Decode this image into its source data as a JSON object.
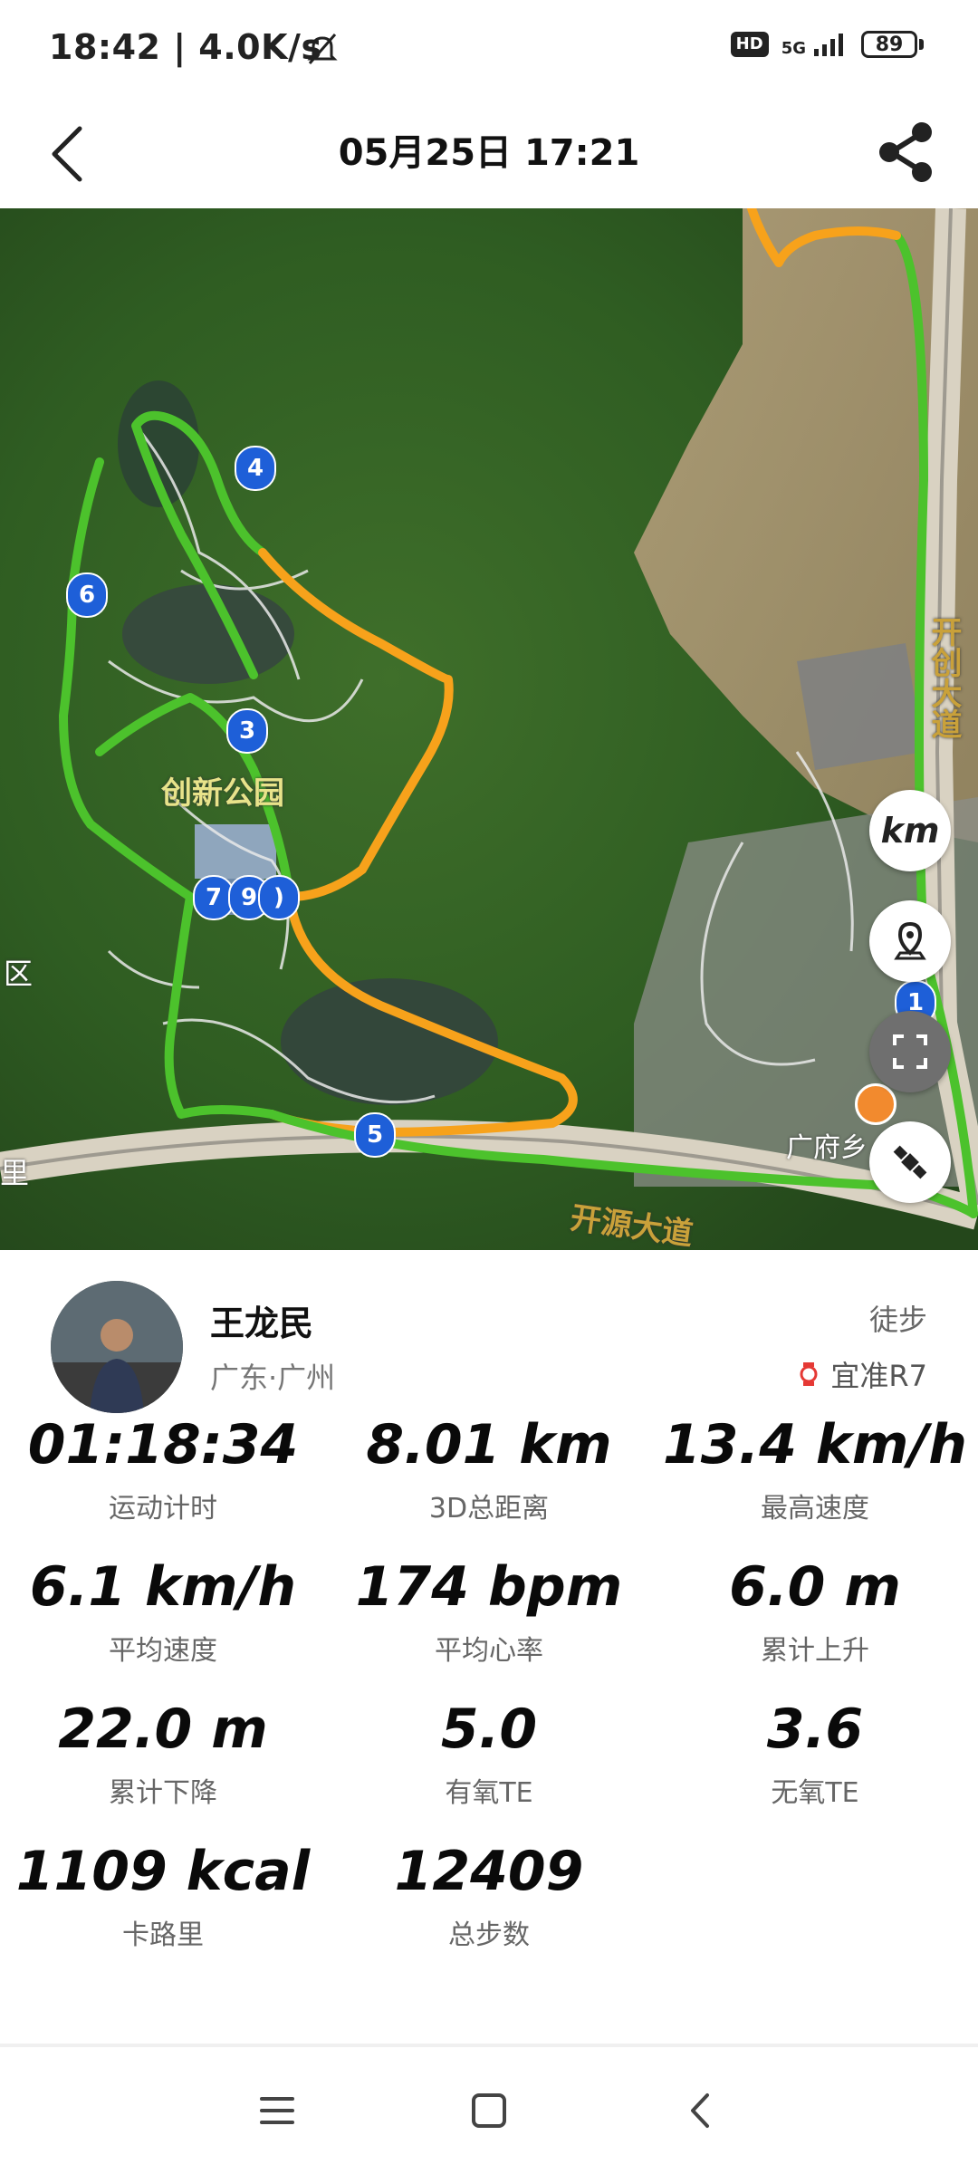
{
  "status_bar": {
    "time_speed": "18:42 | 4.0K/s",
    "hd_badge": "HD",
    "network": "5G",
    "battery": "89"
  },
  "header": {
    "title": "05月25日 17:21"
  },
  "map": {
    "place_label_park": "创新公园",
    "road_label_bottom": "开源大道",
    "road_label_right": "开创大道",
    "poi_label": "广府乡",
    "edge_label_left": "区",
    "edge_label_left_bottom": "里",
    "markers": [
      "4",
      "6",
      "3",
      "7",
      "9",
      ")",
      "1",
      "5"
    ],
    "unit_button": "km",
    "colors": {
      "route_green": "#4cc22c",
      "route_orange": "#f7a21b",
      "marker": "#1e5fd8"
    }
  },
  "profile": {
    "name": "王龙民",
    "location": "广东·广州",
    "activity_type": "徒步",
    "device": "宜准R7"
  },
  "stats": [
    {
      "value": "01:18:34",
      "label": "运动计时"
    },
    {
      "value": "8.01 km",
      "label": "3D总距离"
    },
    {
      "value": "13.4 km/h",
      "label": "最高速度"
    },
    {
      "value": "6.1 km/h",
      "label": "平均速度"
    },
    {
      "value": "174 bpm",
      "label": "平均心率"
    },
    {
      "value": "6.0 m",
      "label": "累计上升"
    },
    {
      "value": "22.0 m",
      "label": "累计下降"
    },
    {
      "value": "5.0",
      "label": "有氧TE"
    },
    {
      "value": "3.6",
      "label": "无氧TE"
    },
    {
      "value": "1109 kcal",
      "label": "卡路里"
    },
    {
      "value": "12409",
      "label": "总步数"
    }
  ]
}
